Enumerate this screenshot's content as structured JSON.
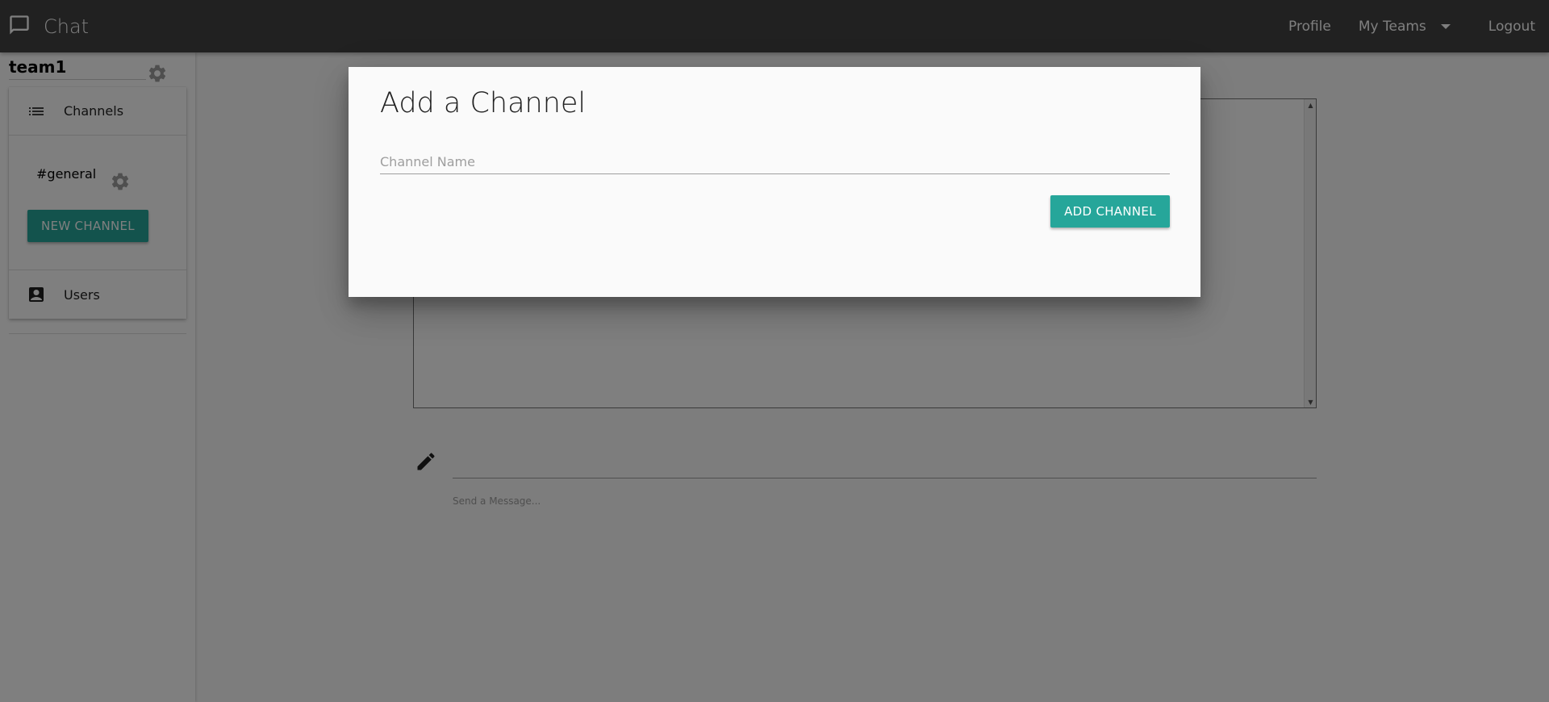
{
  "navbar": {
    "brand": "Chat",
    "links": {
      "profile": "Profile",
      "my_teams": "My Teams",
      "logout": "Logout"
    },
    "bg_color": "#424242"
  },
  "sidebar": {
    "team_name": "team1",
    "sections": {
      "channels_label": "Channels",
      "users_label": "Users"
    },
    "channels": [
      "#general"
    ],
    "new_channel_label": "NEW CHANNEL",
    "accent_color": "#26a69a"
  },
  "main": {
    "message_helper": "Send a Message..."
  },
  "modal": {
    "title": "Add a Channel",
    "channel_name_placeholder": "Channel Name",
    "submit_label": "ADD CHANNEL"
  },
  "icons": {
    "brand": "chat-bubble-icon",
    "channels": "list-icon",
    "users": "contact-card-icon",
    "settings": "gear-icon",
    "compose": "pencil-icon",
    "dropdown": "caret-down-icon"
  }
}
